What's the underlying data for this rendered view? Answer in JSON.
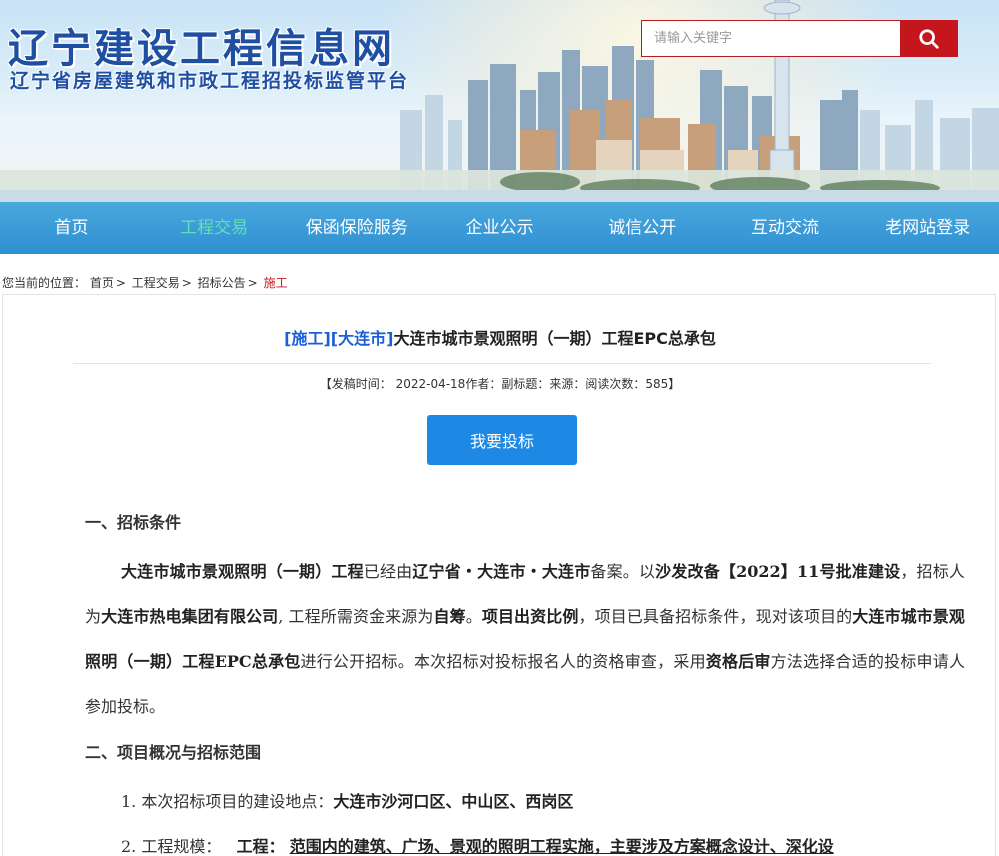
{
  "header": {
    "site_title": "辽宁建设工程信息网",
    "site_subtitle": "辽宁省房屋建筑和市政工程招投标监管平台",
    "search_placeholder": "请输入关键字"
  },
  "nav": {
    "items": [
      "首页",
      "工程交易",
      "保函保险服务",
      "企业公示",
      "诚信公开",
      "互动交流",
      "老网站登录"
    ],
    "active_index": 1
  },
  "breadcrumb": {
    "prefix": "您当前的位置：",
    "items": [
      "首页",
      "工程交易",
      "招标公告"
    ],
    "current": "施工",
    "separator": ">"
  },
  "article": {
    "tag1": "[施工]",
    "tag2": "[大连市]",
    "title": "大连市城市景观照明（一期）工程EPC总承包",
    "meta": "【发稿时间： 2022-04-18作者：副标题：来源：阅读次数：585】",
    "bid_button": "我要投标",
    "section1_heading": "一、招标条件",
    "p1_a": "大连市城市景观照明（一期）工程",
    "p1_b": "已经由",
    "p1_c": "辽宁省・大连市・大连市",
    "p1_d": "备案。以",
    "p1_e": "沙发改备【2022】11号批准建设",
    "p1_f": "，招标人为",
    "p1_g": "大连市热电集团有限公司",
    "p1_h": ", 工程所需资金来源为",
    "p1_i": "自筹",
    "p1_j": "。",
    "p1_k": "项目出资比例",
    "p1_l": "，项目已具备招标条件，现对该项目的",
    "p1_m": "大连市城市景观照明（一期）工程EPC总承包",
    "p1_n": "进行公开招标。本次招标对投标报名人的资格审查，采用",
    "p1_o": "资格后审",
    "p1_p": "方法选择合适的投标申请人参加投标。",
    "section2_heading": "二、项目概况与招标范围",
    "item1_label": "1. 本次招标项目的建设地点：",
    "item1_value": "大连市沙河口区、中山区、西岗区",
    "item2_label": "2. 工程规模：",
    "item2_sublabel": "工程：",
    "item2_value": "范围内的建筑、广场、景观的照明工程实施，主要涉及方案概念设计、深化设"
  },
  "colors": {
    "brand_blue": "#1f4fa3",
    "nav_blue": "#2f8fd0",
    "nav_active": "#5fe0b8",
    "search_red": "#c4161c",
    "button_blue": "#1e88e5",
    "tag_blue": "#1a5fd6",
    "current_red": "#c4161c"
  },
  "icons": {
    "search": "search-icon"
  }
}
